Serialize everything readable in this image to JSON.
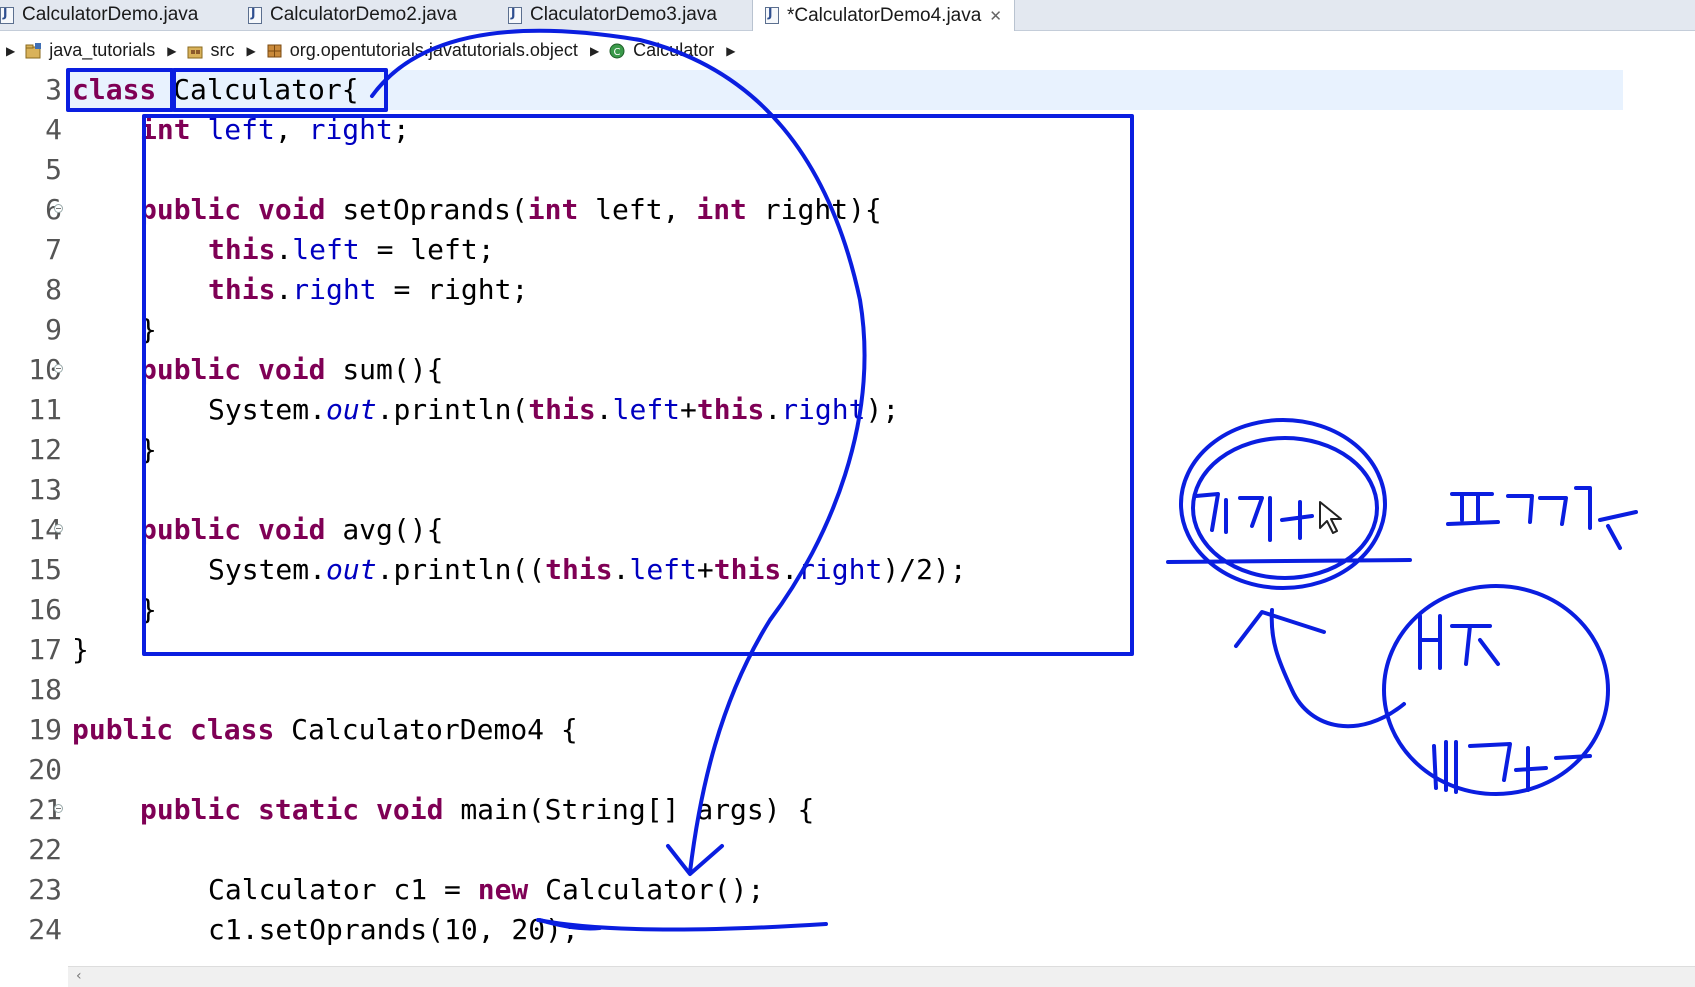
{
  "tabs": [
    {
      "label": "CalculatorDemo.java",
      "active": false
    },
    {
      "label": "CalculatorDemo2.java",
      "active": false
    },
    {
      "label": "ClaculatorDemo3.java",
      "active": false
    },
    {
      "label": "*CalculatorDemo4.java",
      "active": true
    }
  ],
  "tab_close_icon": "close-icon",
  "breadcrumb": [
    {
      "label": "java_tutorials",
      "icon": "project-icon"
    },
    {
      "label": "src",
      "icon": "package-folder-icon"
    },
    {
      "label": "org.opentutorials.javatutorials.object",
      "icon": "package-icon"
    },
    {
      "label": "Calculator",
      "icon": "class-icon"
    }
  ],
  "line_numbers": [
    "3",
    "4",
    "5",
    "6",
    "7",
    "8",
    "9",
    "10",
    "11",
    "12",
    "13",
    "14",
    "15",
    "16",
    "17",
    "18",
    "19",
    "20",
    "21",
    "22",
    "23",
    "24"
  ],
  "code": {
    "l3_kw": "class",
    "l3_name": "Calculator",
    "l3_brace": "{",
    "l4_type": "int",
    "l4_f1": "left",
    "l4_sep": ", ",
    "l4_f2": "right",
    "l4_end": ";",
    "l6_kw1": "public",
    "l6_kw2": "void",
    "l6_sig": "setOprands(",
    "l6_kw3": "int",
    "l6_p1": " left, ",
    "l6_kw4": "int",
    "l6_p2": " right){",
    "l7_this": "this",
    "l7_dot": ".",
    "l7_fld": "left",
    "l7_rest": " = left;",
    "l8_this": "this",
    "l8_dot": ".",
    "l8_fld": "right",
    "l8_rest": " = right;",
    "l9": "}",
    "l10_kw1": "public",
    "l10_kw2": "void",
    "l10_sig": "sum(){",
    "l11_sys": "System.",
    "l11_out": "out",
    "l11_mid": ".println(",
    "l11_this1": "this",
    "l11_dot1": ".",
    "l11_f1": "left",
    "l11_plus": "+",
    "l11_this2": "this",
    "l11_dot2": ".",
    "l11_f2": "right",
    "l11_end": ");",
    "l12": "}",
    "l14_kw1": "public",
    "l14_kw2": "void",
    "l14_sig": "avg(){",
    "l15_sys": "System.",
    "l15_out": "out",
    "l15_mid": ".println((",
    "l15_this1": "this",
    "l15_dot1": ".",
    "l15_f1": "left",
    "l15_plus": "+",
    "l15_this2": "this",
    "l15_dot2": ".",
    "l15_f2": "right",
    "l15_end": ")/2);",
    "l16": "}",
    "l17": "}",
    "l19_kw1": "public",
    "l19_kw2": "class",
    "l19_rest": "CalculatorDemo4 {",
    "l21_kw1": "public",
    "l21_kw2": "static",
    "l21_kw3": "void",
    "l21_rest": "main(String[] args) {",
    "l23_a": "Calculator c1 = ",
    "l23_kw": "new",
    "l23_b": " Calculator();",
    "l24": "c1.setOprands(10, 20);"
  },
  "colors": {
    "keyword": "#7f0055",
    "field": "#0000c0",
    "annotation_ink": "#0a1ee0",
    "current_line": "#e8f2fe"
  }
}
